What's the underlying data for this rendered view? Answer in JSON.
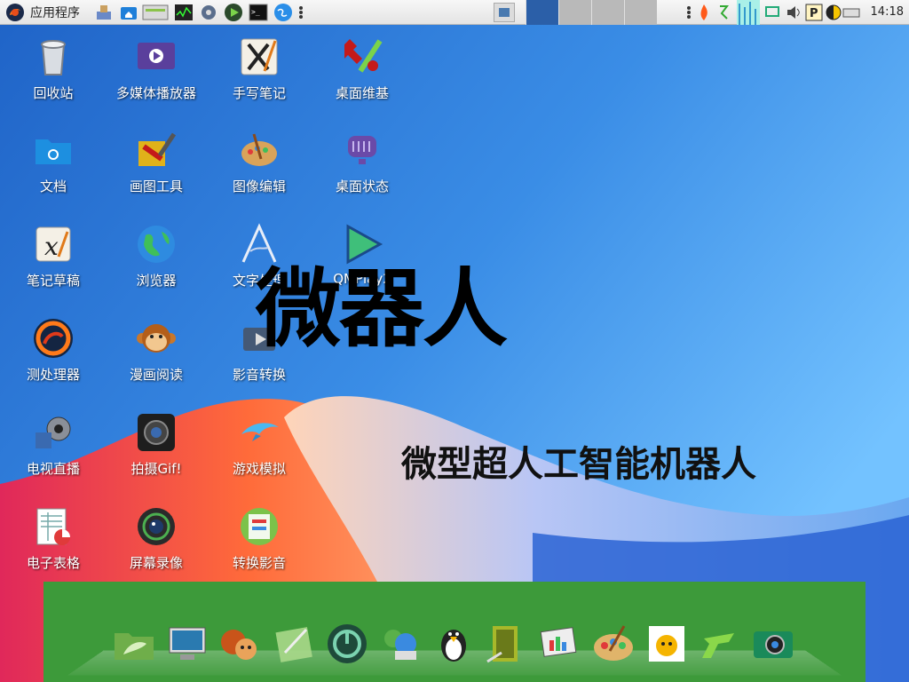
{
  "panel": {
    "menu_label": "应用程序",
    "clock": "14:18",
    "workspaces": [
      "1",
      "2",
      "3",
      "4"
    ],
    "tray_icons": [
      "flame-icon",
      "network-icon",
      "graph-icon",
      "sync-icon",
      "volume-icon",
      "p-icon",
      "contrast-icon",
      "keyboard-icon"
    ],
    "launchers": [
      "paint-icon",
      "home-folder-icon",
      "monitor-icon",
      "system-monitor-icon",
      "settings-icon",
      "play-icon",
      "terminal-icon",
      "browser-globe-icon",
      "more-icon"
    ]
  },
  "desktop": {
    "icons": [
      {
        "label": "回收站",
        "icon": "trash-icon"
      },
      {
        "label": "多媒体播放器",
        "icon": "media-player-icon"
      },
      {
        "label": "手写笔记",
        "icon": "handwriting-icon"
      },
      {
        "label": "桌面维基",
        "icon": "wiki-icon"
      },
      {
        "label": "文档",
        "icon": "folder-icon"
      },
      {
        "label": "画图工具",
        "icon": "paint-tool-icon"
      },
      {
        "label": "图像编辑",
        "icon": "palette-icon"
      },
      {
        "label": "桌面状态",
        "icon": "desktop-status-icon"
      },
      {
        "label": "笔记草稿",
        "icon": "xournal-icon"
      },
      {
        "label": "浏览器",
        "icon": "globe-icon"
      },
      {
        "label": "文字处理",
        "icon": "abiword-icon"
      },
      {
        "label": "QMPlay2",
        "icon": "qmplay-icon"
      },
      {
        "label": "测处理器",
        "icon": "firefox-swirl-icon"
      },
      {
        "label": "漫画阅读",
        "icon": "monkey-icon"
      },
      {
        "label": "影音转换",
        "icon": "video-convert-icon"
      },
      {
        "label": "电视直播",
        "icon": "tv-icon"
      },
      {
        "label": "拍摄Gif!",
        "icon": "camera-gif-icon"
      },
      {
        "label": "游戏模拟",
        "icon": "dolphin-icon"
      },
      {
        "label": "电子表格",
        "icon": "spreadsheet-icon"
      },
      {
        "label": "屏幕录像",
        "icon": "screen-record-icon"
      },
      {
        "label": "转换影音",
        "icon": "convert-media-icon"
      }
    ],
    "title": "微器人",
    "subtitle": "微型超人工智能机器人"
  },
  "dock": {
    "items": [
      "leaf-folder-icon",
      "computer-icon",
      "squirrel-icon",
      "notepad-icon",
      "power-icon",
      "messenger-icon",
      "penguin-icon",
      "book-icon",
      "presentation-icon",
      "paint-palette-icon",
      "photo-icon",
      "p-logo-icon",
      "camera-icon"
    ]
  },
  "colors": {
    "dock_bg": "#3d9a3a",
    "panel_bg": "#ececec",
    "workspace_active": "#2b5fa8"
  }
}
